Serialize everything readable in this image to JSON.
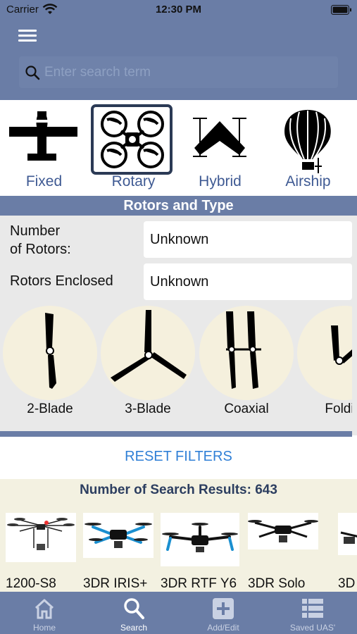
{
  "status_bar": {
    "carrier": "Carrier",
    "time": "12:30 PM"
  },
  "search": {
    "placeholder": "Enter search term"
  },
  "categories": [
    {
      "label": "Fixed",
      "icon": "fixed-wing-airplane-icon",
      "selected": false
    },
    {
      "label": "Rotary",
      "icon": "quadcopter-icon",
      "selected": true
    },
    {
      "label": "Hybrid",
      "icon": "hybrid-vtol-icon",
      "selected": false
    },
    {
      "label": "Airship",
      "icon": "hot-air-balloon-icon",
      "selected": false
    }
  ],
  "section": {
    "title": "Rotors and Type"
  },
  "filters": {
    "rotors_label_line1": "Number",
    "rotors_label_line2": "of Rotors:",
    "rotors_value": "Unknown",
    "enclosed_label": "Rotors Enclosed",
    "enclosed_value": "Unknown"
  },
  "blade_types": [
    {
      "label": "2-Blade",
      "icon": "two-blade-propeller-icon"
    },
    {
      "label": "3-Blade",
      "icon": "three-blade-propeller-icon"
    },
    {
      "label": "Coaxial",
      "icon": "coaxial-propeller-icon"
    },
    {
      "label": "Foldi",
      "icon": "folding-propeller-icon"
    }
  ],
  "reset_label": "RESET FILTERS",
  "results": {
    "count_label": "Number of Search Results: 643",
    "items": [
      {
        "name": "1200-S8"
      },
      {
        "name": "3DR IRIS+"
      },
      {
        "name": "3DR RTF Y6"
      },
      {
        "name": "3DR Solo"
      },
      {
        "name": "3D"
      }
    ]
  },
  "tabs": [
    {
      "label": "Home",
      "icon": "home-icon",
      "active": false
    },
    {
      "label": "Search",
      "icon": "search-icon",
      "active": true
    },
    {
      "label": "Add/Edit",
      "icon": "add-icon",
      "active": false
    },
    {
      "label": "Saved UAS'",
      "icon": "list-icon",
      "active": false
    }
  ],
  "colors": {
    "header": "#6a7da6",
    "accent_link": "#2f7fd6",
    "category_label": "#3f5a93",
    "results_bg": "#f3f1e1"
  }
}
